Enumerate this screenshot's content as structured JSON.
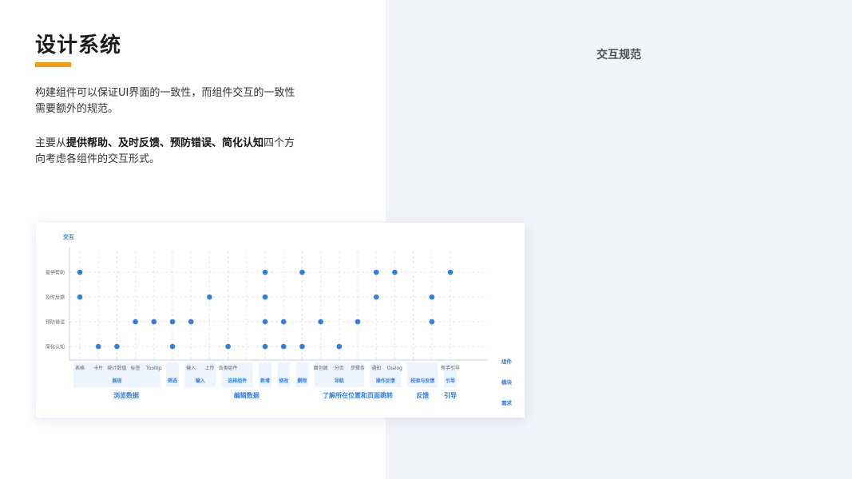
{
  "page": {
    "title": "设计系统",
    "accent_color": "#f59a12",
    "intro_text": "构建组件可以保证UI界面的一致性，而组件交互的一致性需要额外的规范。",
    "direction_prefix": "主要从",
    "direction_bold": "提供帮助、及时反馈、预防错误、简化认知",
    "direction_suffix": "四个方向考虑各组件的交互形式。",
    "right_title": "交互规范"
  },
  "chart_data": {
    "type": "scatter",
    "title": "",
    "ylabel": "交互",
    "dot_color": "#2f7fe8",
    "label_color": "#2f7fe8",
    "rows": [
      "提供帮助",
      "及时反馈",
      "预防错误",
      "简化认知"
    ],
    "row_labels": {
      "component": "组件",
      "module": "模块",
      "requirement": "需求"
    },
    "components": [
      "表格",
      "卡片",
      "统计数值",
      "标签",
      "Tooltip",
      "",
      "输入",
      "上传",
      "各类组件",
      "",
      "",
      "",
      "",
      "面包屑",
      "分页",
      "步骤条",
      "通知",
      "Dialog",
      "",
      "",
      "新手引导"
    ],
    "modules": [
      {
        "label": "展现",
        "start": 0,
        "end": 4
      },
      {
        "label": "筛选",
        "start": 5,
        "end": 5
      },
      {
        "label": "输入",
        "start": 6,
        "end": 7
      },
      {
        "label": "选择组件",
        "start": 8,
        "end": 9
      },
      {
        "label": "新增",
        "start": 10,
        "end": 10
      },
      {
        "label": "修改",
        "start": 11,
        "end": 11
      },
      {
        "label": "删除",
        "start": 12,
        "end": 12
      },
      {
        "label": "导航",
        "start": 13,
        "end": 15
      },
      {
        "label": "操作反馈",
        "start": 16,
        "end": 17
      },
      {
        "label": "校验与反馈",
        "start": 18,
        "end": 19
      },
      {
        "label": "引导",
        "start": 20,
        "end": 20
      }
    ],
    "requirements": [
      {
        "label": "浏览数据",
        "start": 0,
        "end": 5
      },
      {
        "label": "编辑数据",
        "start": 6,
        "end": 12
      },
      {
        "label": "了解所在位置和页面跳转",
        "start": 13,
        "end": 17
      },
      {
        "label": "反馈",
        "start": 18,
        "end": 19
      },
      {
        "label": "引导",
        "start": 20,
        "end": 20
      }
    ],
    "points": [
      {
        "col": 0,
        "row": 0
      },
      {
        "col": 0,
        "row": 1
      },
      {
        "col": 1,
        "row": 3
      },
      {
        "col": 2,
        "row": 3
      },
      {
        "col": 3,
        "row": 2
      },
      {
        "col": 4,
        "row": 2
      },
      {
        "col": 5,
        "row": 2
      },
      {
        "col": 5,
        "row": 3
      },
      {
        "col": 6,
        "row": 2
      },
      {
        "col": 7,
        "row": 1
      },
      {
        "col": 8,
        "row": 3
      },
      {
        "col": 10,
        "row": 0
      },
      {
        "col": 10,
        "row": 1
      },
      {
        "col": 10,
        "row": 2
      },
      {
        "col": 10,
        "row": 3
      },
      {
        "col": 11,
        "row": 2
      },
      {
        "col": 11,
        "row": 3
      },
      {
        "col": 12,
        "row": 0
      },
      {
        "col": 12,
        "row": 3
      },
      {
        "col": 13,
        "row": 2
      },
      {
        "col": 14,
        "row": 3
      },
      {
        "col": 15,
        "row": 2
      },
      {
        "col": 16,
        "row": 0
      },
      {
        "col": 16,
        "row": 1
      },
      {
        "col": 17,
        "row": 0
      },
      {
        "col": 19,
        "row": 1
      },
      {
        "col": 19,
        "row": 2
      },
      {
        "col": 20,
        "row": 0
      }
    ]
  }
}
